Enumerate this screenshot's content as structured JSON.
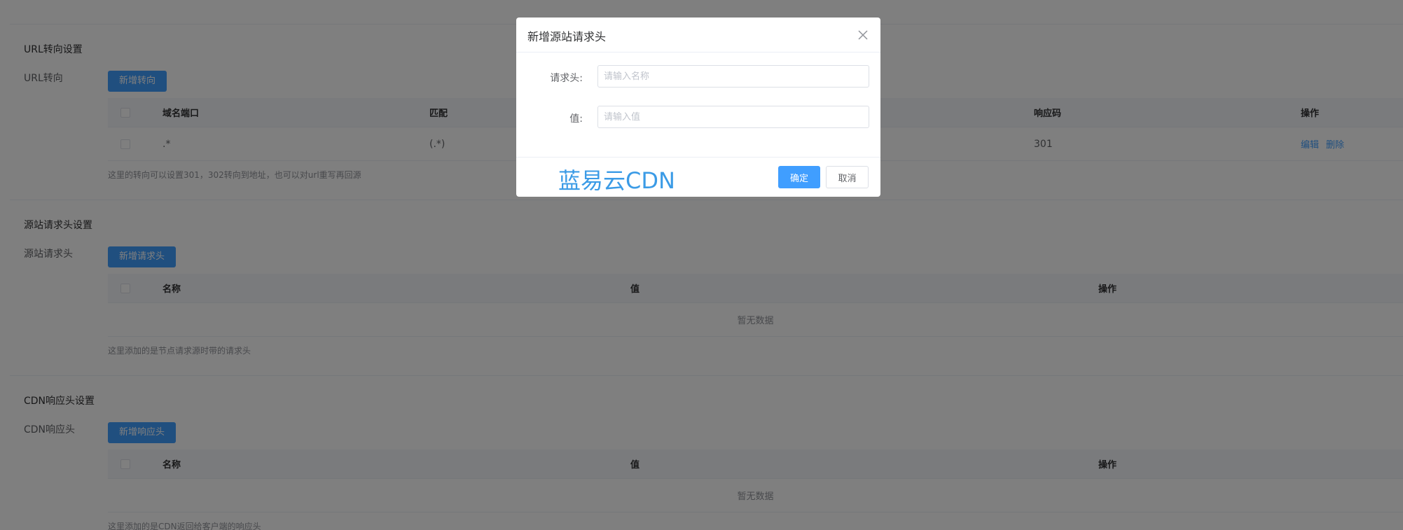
{
  "url_section": {
    "title": "URL转向设置",
    "label": "URL转向",
    "add_button": "新增转向",
    "columns": [
      "域名端口",
      "匹配",
      "响应码",
      "操作"
    ],
    "rows": [
      {
        "domain_port": ".*",
        "match": "(.*)",
        "code": "301",
        "edit": "编辑",
        "delete": "删除"
      }
    ],
    "hint": "这里的转向可以设置301，302转向到地址，也可以对url重写再回源"
  },
  "origin_section": {
    "title": "源站请求头设置",
    "label": "源站请求头",
    "add_button": "新增请求头",
    "columns": [
      "名称",
      "值",
      "操作"
    ],
    "empty_text": "暂无数据",
    "hint": "这里添加的是节点请求源时带的请求头"
  },
  "cdn_section": {
    "title": "CDN响应头设置",
    "label": "CDN响应头",
    "add_button": "新增响应头",
    "columns": [
      "名称",
      "值",
      "操作"
    ],
    "empty_text": "暂无数据",
    "hint": "这里添加的是CDN返回给客户端的响应头"
  },
  "dialog": {
    "title": "新增源站请求头",
    "fields": {
      "header_label": "请求头:",
      "header_placeholder": "请输入名称",
      "value_label": "值:",
      "value_placeholder": "请输入值"
    },
    "watermark": "蓝易云CDN",
    "confirm": "确定",
    "cancel": "取消"
  },
  "icons": {
    "close": "close-icon"
  },
  "colors": {
    "primary": "#409eff",
    "overlay": "rgba(0,0,0,0.5)",
    "watermark": "#3b9be6"
  }
}
